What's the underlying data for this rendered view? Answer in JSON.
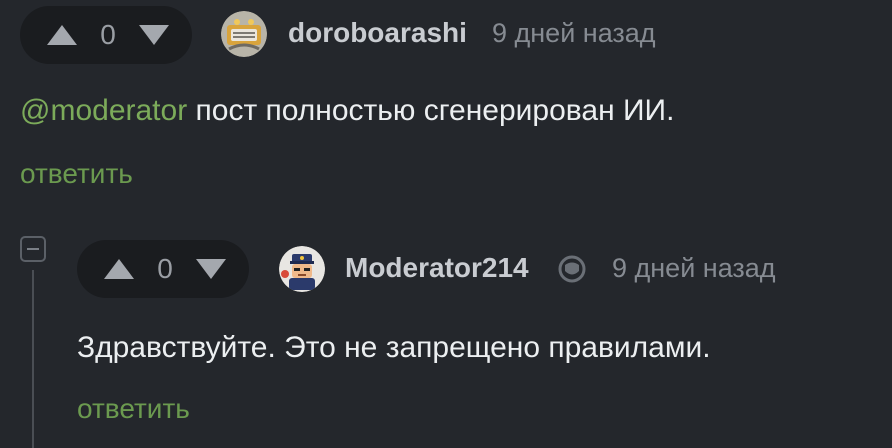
{
  "comment": {
    "votes": "0",
    "username": "doroboarashi",
    "timestamp": "9 дней назад",
    "mention": "@moderator",
    "text": " пост полностью сгенерирован ИИ.",
    "reply_label": "ответить"
  },
  "reply": {
    "votes": "0",
    "username": "Moderator214",
    "badge_icon": "moderator-badge-icon",
    "timestamp": "9 дней назад",
    "text": "Здравствуйте. Это не запрещено правилами.",
    "reply_label": "ответить"
  },
  "colors": {
    "background": "#24272c",
    "pill": "#1a1c1f",
    "accent_green": "#6b9a4f",
    "mention_green": "#7cab5a"
  }
}
